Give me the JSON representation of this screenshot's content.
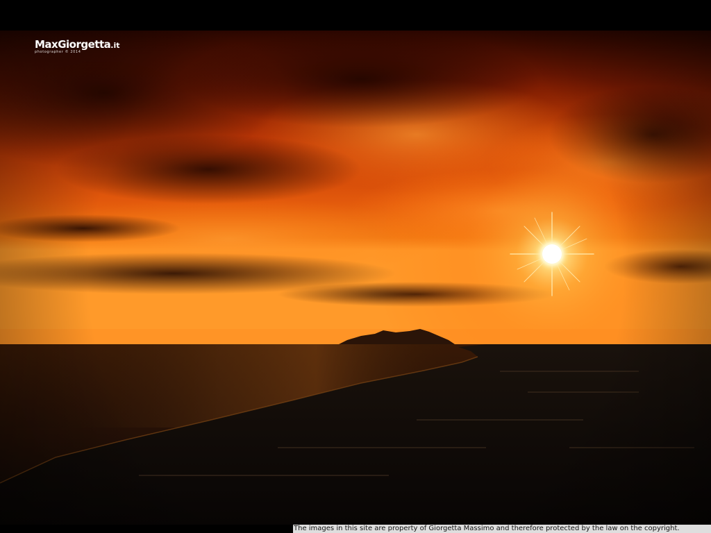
{
  "watermark": {
    "brand": "MaxGiorgetta",
    "tld": ".it",
    "subtitle": "photographer © 2014"
  },
  "footer": {
    "copyright_notice": "The images in this site are property of Giorgetta Massimo and therefore protected by the law on the copyright."
  },
  "photo": {
    "subject": "sunset-over-coastline",
    "colors": {
      "sky_top": "#3a0a00",
      "sky_mid": "#d8460a",
      "sky_horizon": "#ff8a1a",
      "sun": "#fff8d0",
      "sea": "#1a0d06",
      "land": "#0c0806"
    }
  }
}
